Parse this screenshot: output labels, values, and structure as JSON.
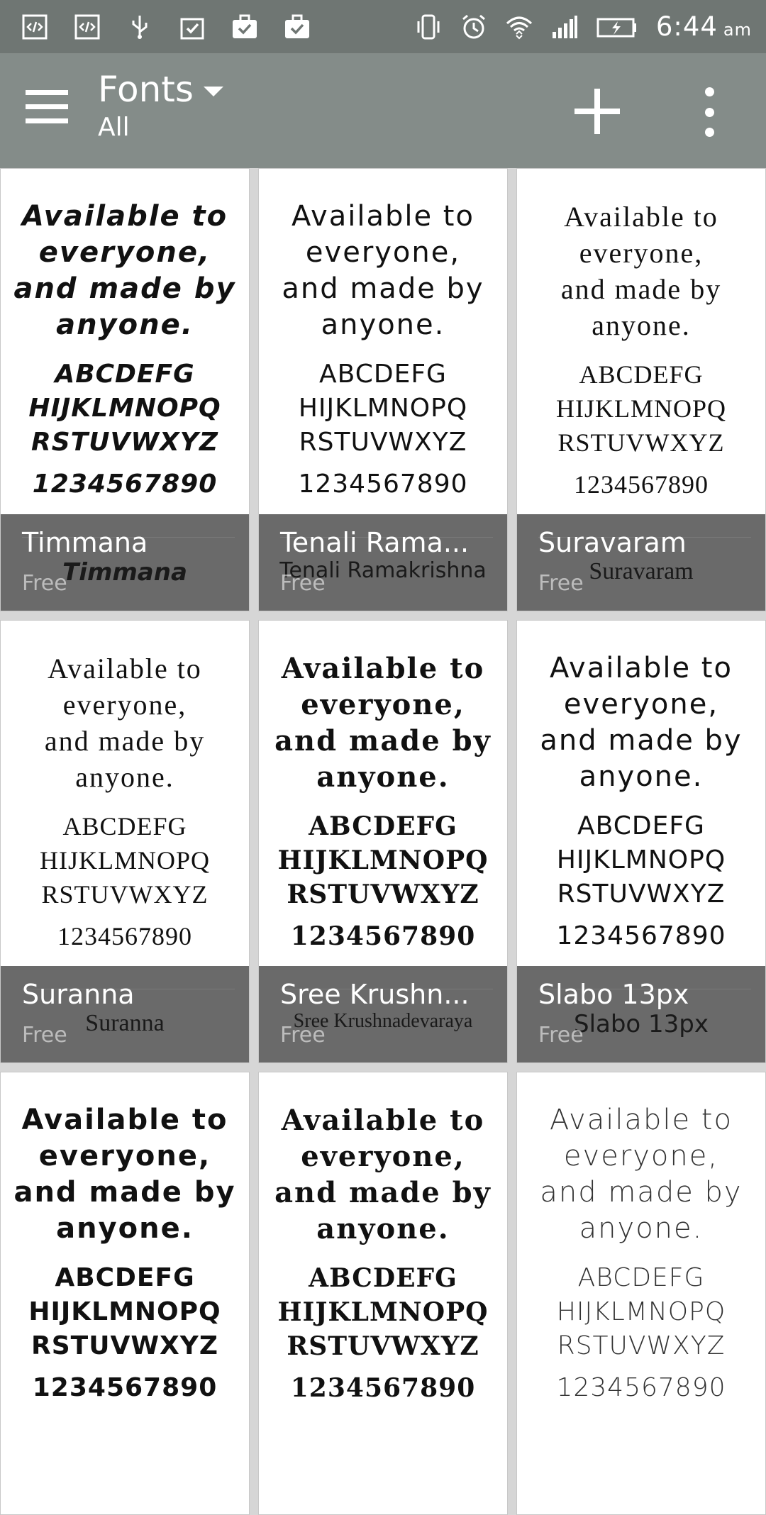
{
  "status_bar": {
    "time": "6:44",
    "ampm": "am",
    "icons": [
      "code-icon",
      "code-icon",
      "usb-icon",
      "clipboard-check-icon",
      "briefcase-check-icon",
      "briefcase-check-icon",
      "vibrate-icon",
      "alarm-icon",
      "wifi-icon",
      "signal-icon",
      "battery-charging-icon"
    ]
  },
  "toolbar": {
    "title": "Fonts",
    "subtitle": "All",
    "background": "#848c89"
  },
  "sample": {
    "line1": "Available to",
    "line2": "everyone,",
    "line3": "and made by",
    "line4": "anyone.",
    "alpha1": "ABCDEFG",
    "alpha2": "HIJKLMNOPQ",
    "alpha3": "RSTUVWXYZ",
    "digits": "1234567890"
  },
  "fonts": [
    {
      "name": "Timmana",
      "preview_name": "Timmana",
      "price": "Free"
    },
    {
      "name": "Tenali Rama...",
      "preview_name": "Tenali Ramakrishna",
      "price": "Free"
    },
    {
      "name": "Suravaram",
      "preview_name": "Suravaram",
      "price": "Free"
    },
    {
      "name": "Suranna",
      "preview_name": "Suranna",
      "price": "Free"
    },
    {
      "name": "Sree Krushn...",
      "preview_name": "Sree Krushnadevaraya",
      "price": "Free"
    },
    {
      "name": "Slabo 13px",
      "preview_name": "Slabo 13px",
      "price": "Free"
    },
    {
      "name": "",
      "preview_name": "",
      "price": ""
    },
    {
      "name": "",
      "preview_name": "",
      "price": ""
    },
    {
      "name": "",
      "preview_name": "",
      "price": ""
    }
  ]
}
